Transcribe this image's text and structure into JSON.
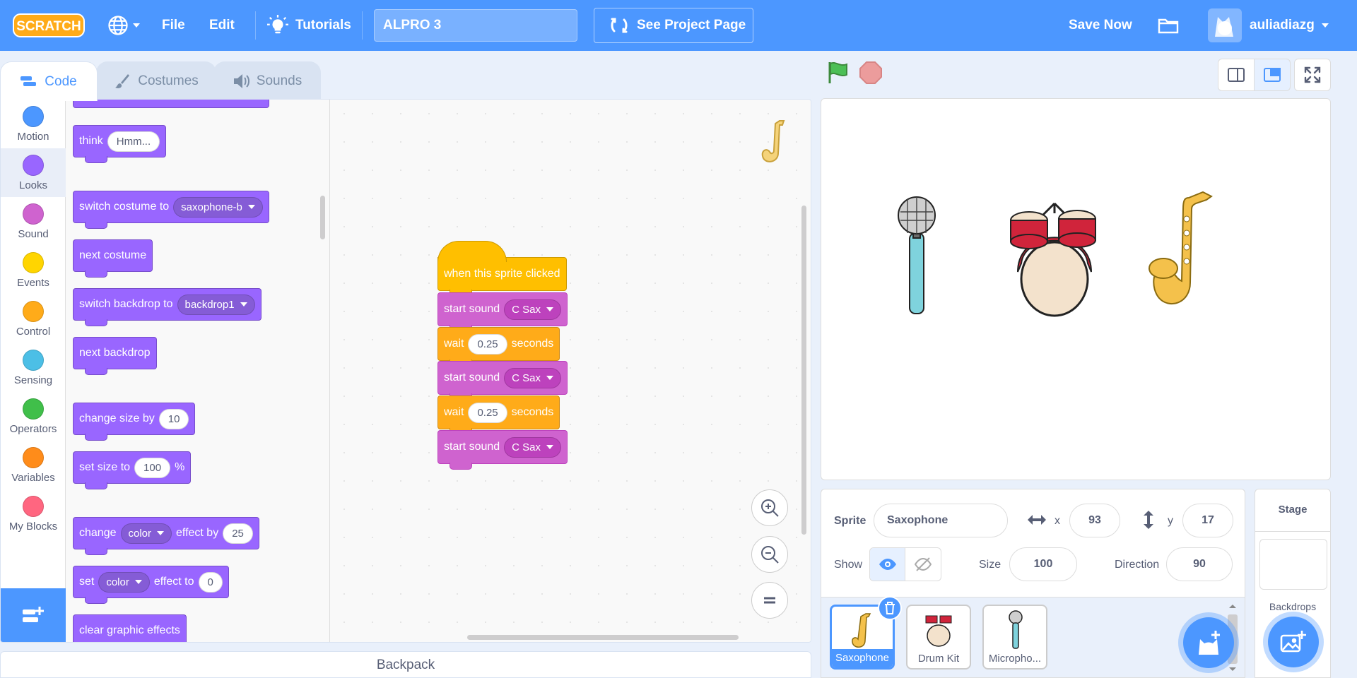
{
  "menu": {
    "logo": "SCRATCH",
    "file": "File",
    "edit": "Edit",
    "tutorials": "Tutorials",
    "project_title": "ALPRO 3",
    "see_project": "See Project Page",
    "save_now": "Save Now",
    "username": "auliadiazg"
  },
  "tabs": {
    "code": "Code",
    "costumes": "Costumes",
    "sounds": "Sounds"
  },
  "categories": [
    {
      "label": "Motion",
      "color": "#4c97ff"
    },
    {
      "label": "Looks",
      "color": "#9966ff"
    },
    {
      "label": "Sound",
      "color": "#cf63cf"
    },
    {
      "label": "Events",
      "color": "#ffd500"
    },
    {
      "label": "Control",
      "color": "#ffab19"
    },
    {
      "label": "Sensing",
      "color": "#4cbfe6"
    },
    {
      "label": "Operators",
      "color": "#40bf4a"
    },
    {
      "label": "Variables",
      "color": "#ff8c1a"
    },
    {
      "label": "My Blocks",
      "color": "#ff6680"
    }
  ],
  "palette": {
    "think": "think",
    "think_value": "Hmm...",
    "switch_costume": "switch costume to",
    "costume_value": "saxophone-b",
    "next_costume": "next costume",
    "switch_backdrop": "switch backdrop to",
    "backdrop_value": "backdrop1",
    "next_backdrop": "next backdrop",
    "change_size": "change size by",
    "change_size_value": "10",
    "set_size": "set size to",
    "set_size_value": "100",
    "set_size_unit": "%",
    "change_effect": "change",
    "change_effect_dd": "color",
    "change_effect_by": "effect by",
    "change_effect_value": "25",
    "set_effect": "set",
    "set_effect_dd": "color",
    "set_effect_to": "effect to",
    "set_effect_value": "0",
    "clear_effects": "clear graphic effects"
  },
  "script": {
    "hat": "when this sprite clicked",
    "start_sound": "start sound",
    "sound_value": "C Sax",
    "wait": "wait",
    "wait_value": "0.25",
    "seconds": "seconds"
  },
  "backpack": "Backpack",
  "sprite_info": {
    "sprite_label": "Sprite",
    "sprite_name": "Saxophone",
    "x_label": "x",
    "x_value": "93",
    "y_label": "y",
    "y_value": "17",
    "show_label": "Show",
    "size_label": "Size",
    "size_value": "100",
    "direction_label": "Direction",
    "direction_value": "90"
  },
  "sprites": [
    {
      "name": "Saxophone",
      "selected": true
    },
    {
      "name": "Drum Kit",
      "selected": false
    },
    {
      "name": "Micropho...",
      "selected": false
    }
  ],
  "stage_pane": {
    "title": "Stage",
    "backdrops": "Backdrops"
  }
}
